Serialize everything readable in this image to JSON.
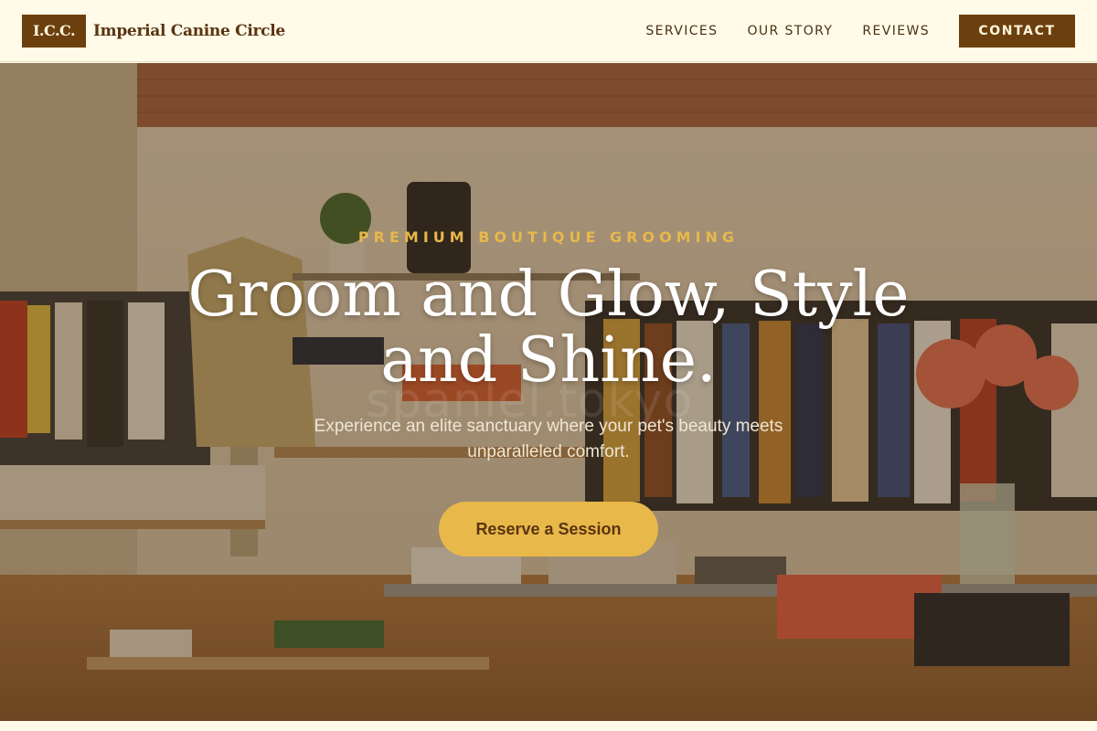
{
  "header": {
    "logo_text": "I.C.C.",
    "brand_name": "Imperial Canine Circle",
    "nav": [
      {
        "label": "SERVICES"
      },
      {
        "label": "OUR STORY"
      },
      {
        "label": "REVIEWS"
      }
    ],
    "contact_label": "CONTACT"
  },
  "hero": {
    "eyebrow": "PREMIUM BOUTIQUE GROOMING",
    "headline": "Groom and Glow, Style and Shine.",
    "subhead": "Experience an elite sanctuary where your pet's beauty meets unparalleled comfort.",
    "cta_label": "Reserve a Session",
    "watermark": "spanlel.tokyo"
  },
  "colors": {
    "brand": "#6b3f0e",
    "accent": "#e8b84a",
    "background": "#fffbe8"
  }
}
